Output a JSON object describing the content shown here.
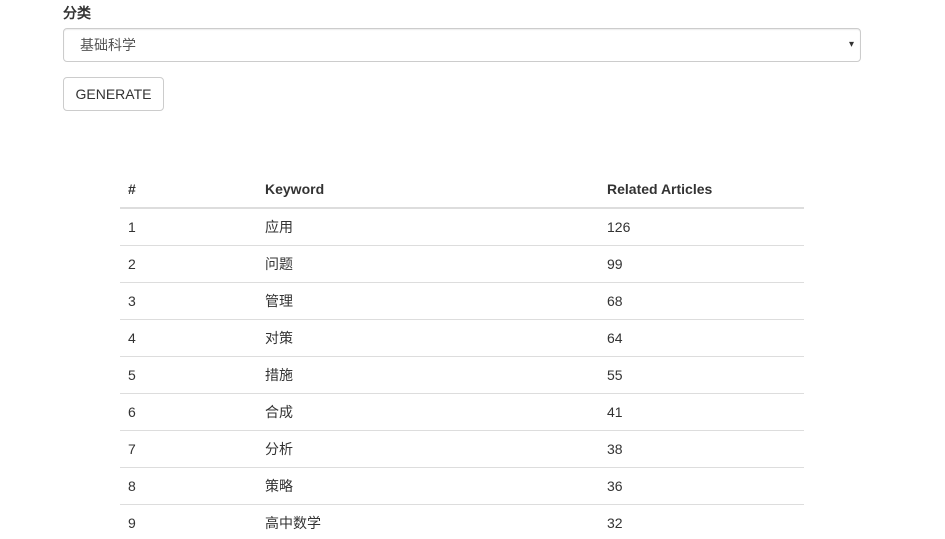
{
  "form": {
    "category_label": "分类",
    "category_selected": "基础科学",
    "caret": "▾",
    "generate_label": "GENERATE"
  },
  "table": {
    "headers": [
      "#",
      "Keyword",
      "Related Articles"
    ],
    "rows": [
      {
        "num": "1",
        "keyword": "应用",
        "count": "126"
      },
      {
        "num": "2",
        "keyword": "问题",
        "count": "99"
      },
      {
        "num": "3",
        "keyword": "管理",
        "count": "68"
      },
      {
        "num": "4",
        "keyword": "对策",
        "count": "64"
      },
      {
        "num": "5",
        "keyword": "措施",
        "count": "55"
      },
      {
        "num": "6",
        "keyword": "合成",
        "count": "41"
      },
      {
        "num": "7",
        "keyword": "分析",
        "count": "38"
      },
      {
        "num": "8",
        "keyword": "策略",
        "count": "36"
      },
      {
        "num": "9",
        "keyword": "高中数学",
        "count": "32"
      }
    ]
  }
}
